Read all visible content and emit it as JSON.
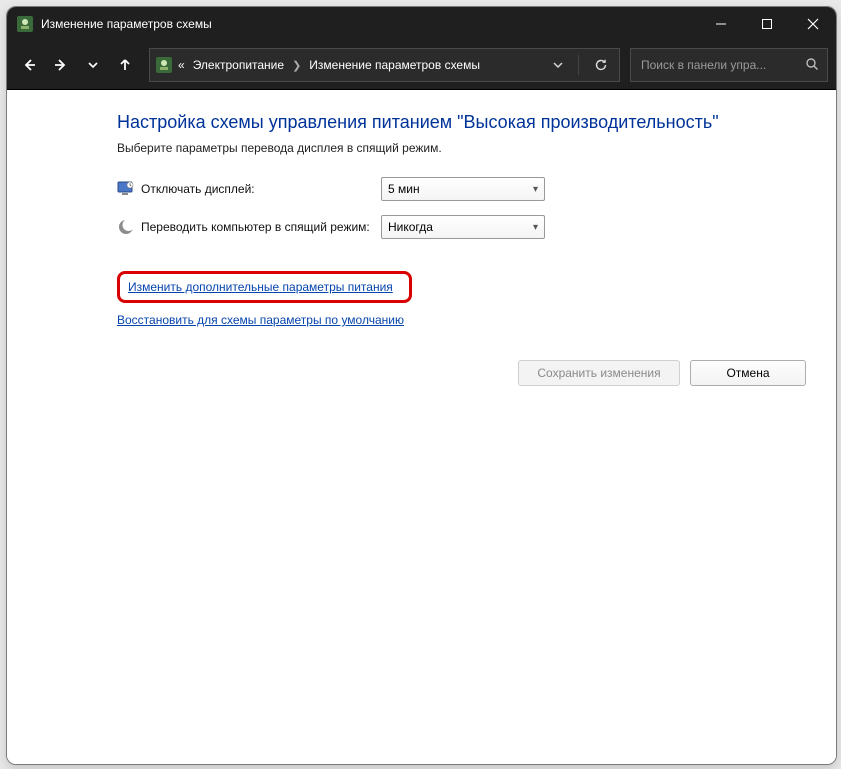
{
  "titlebar": {
    "title": "Изменение параметров схемы"
  },
  "breadcrumb": {
    "root_prefix": "«",
    "item1": "Электропитание",
    "item2": "Изменение параметров схемы"
  },
  "search": {
    "placeholder": "Поиск в панели упра..."
  },
  "page": {
    "heading": "Настройка схемы управления питанием \"Высокая производительность\"",
    "subtitle": "Выберите параметры перевода дисплея в спящий режим."
  },
  "settings": {
    "display_off_label": "Отключать дисплей:",
    "display_off_value": "5 мин",
    "sleep_label": "Переводить компьютер в спящий режим:",
    "sleep_value": "Никогда"
  },
  "links": {
    "advanced": "Изменить дополнительные параметры питания",
    "restore": "Восстановить для схемы параметры по умолчанию"
  },
  "buttons": {
    "save": "Сохранить изменения",
    "cancel": "Отмена"
  }
}
